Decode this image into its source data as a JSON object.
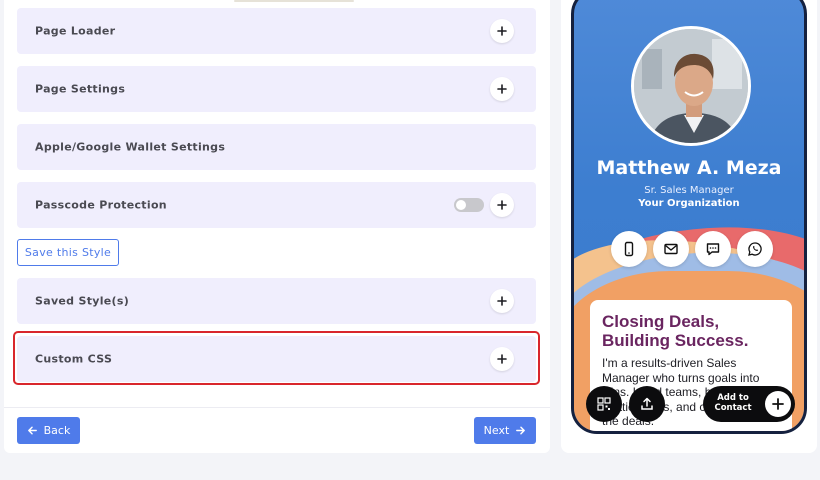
{
  "settings": {
    "page_loader": "Page Loader",
    "page_settings": "Page Settings",
    "wallet_settings": "Apple/Google Wallet Settings",
    "passcode_protection": "Passcode Protection",
    "passcode_enabled": false,
    "save_style": "Save this Style",
    "saved_styles": "Saved Style(s)",
    "custom_css": "Custom CSS"
  },
  "footer": {
    "back_label": "Back",
    "next_label": "Next"
  },
  "preview": {
    "name": "Matthew A. Meza",
    "role": "Sr. Sales Manager",
    "organization": "Your Organization",
    "contact_icons": [
      "phone-icon",
      "mail-icon",
      "message-icon",
      "whatsapp-icon"
    ],
    "bio_headline_line1": "Closing Deals,",
    "bio_headline_line2": "Building Success.",
    "bio_text_lines": [
      "I'm a results-driven Sales",
      "Manager who turns goals into",
      "wins. I lead teams, build",
      "relationships, and close",
      "the deals."
    ],
    "add_contact_line1": "Add to",
    "add_contact_line2": "Contact"
  },
  "colors": {
    "accent": "#4f7bea",
    "highlight": "#d9262c",
    "row_bg": "#f0eefd",
    "headline": "#6a2560"
  }
}
